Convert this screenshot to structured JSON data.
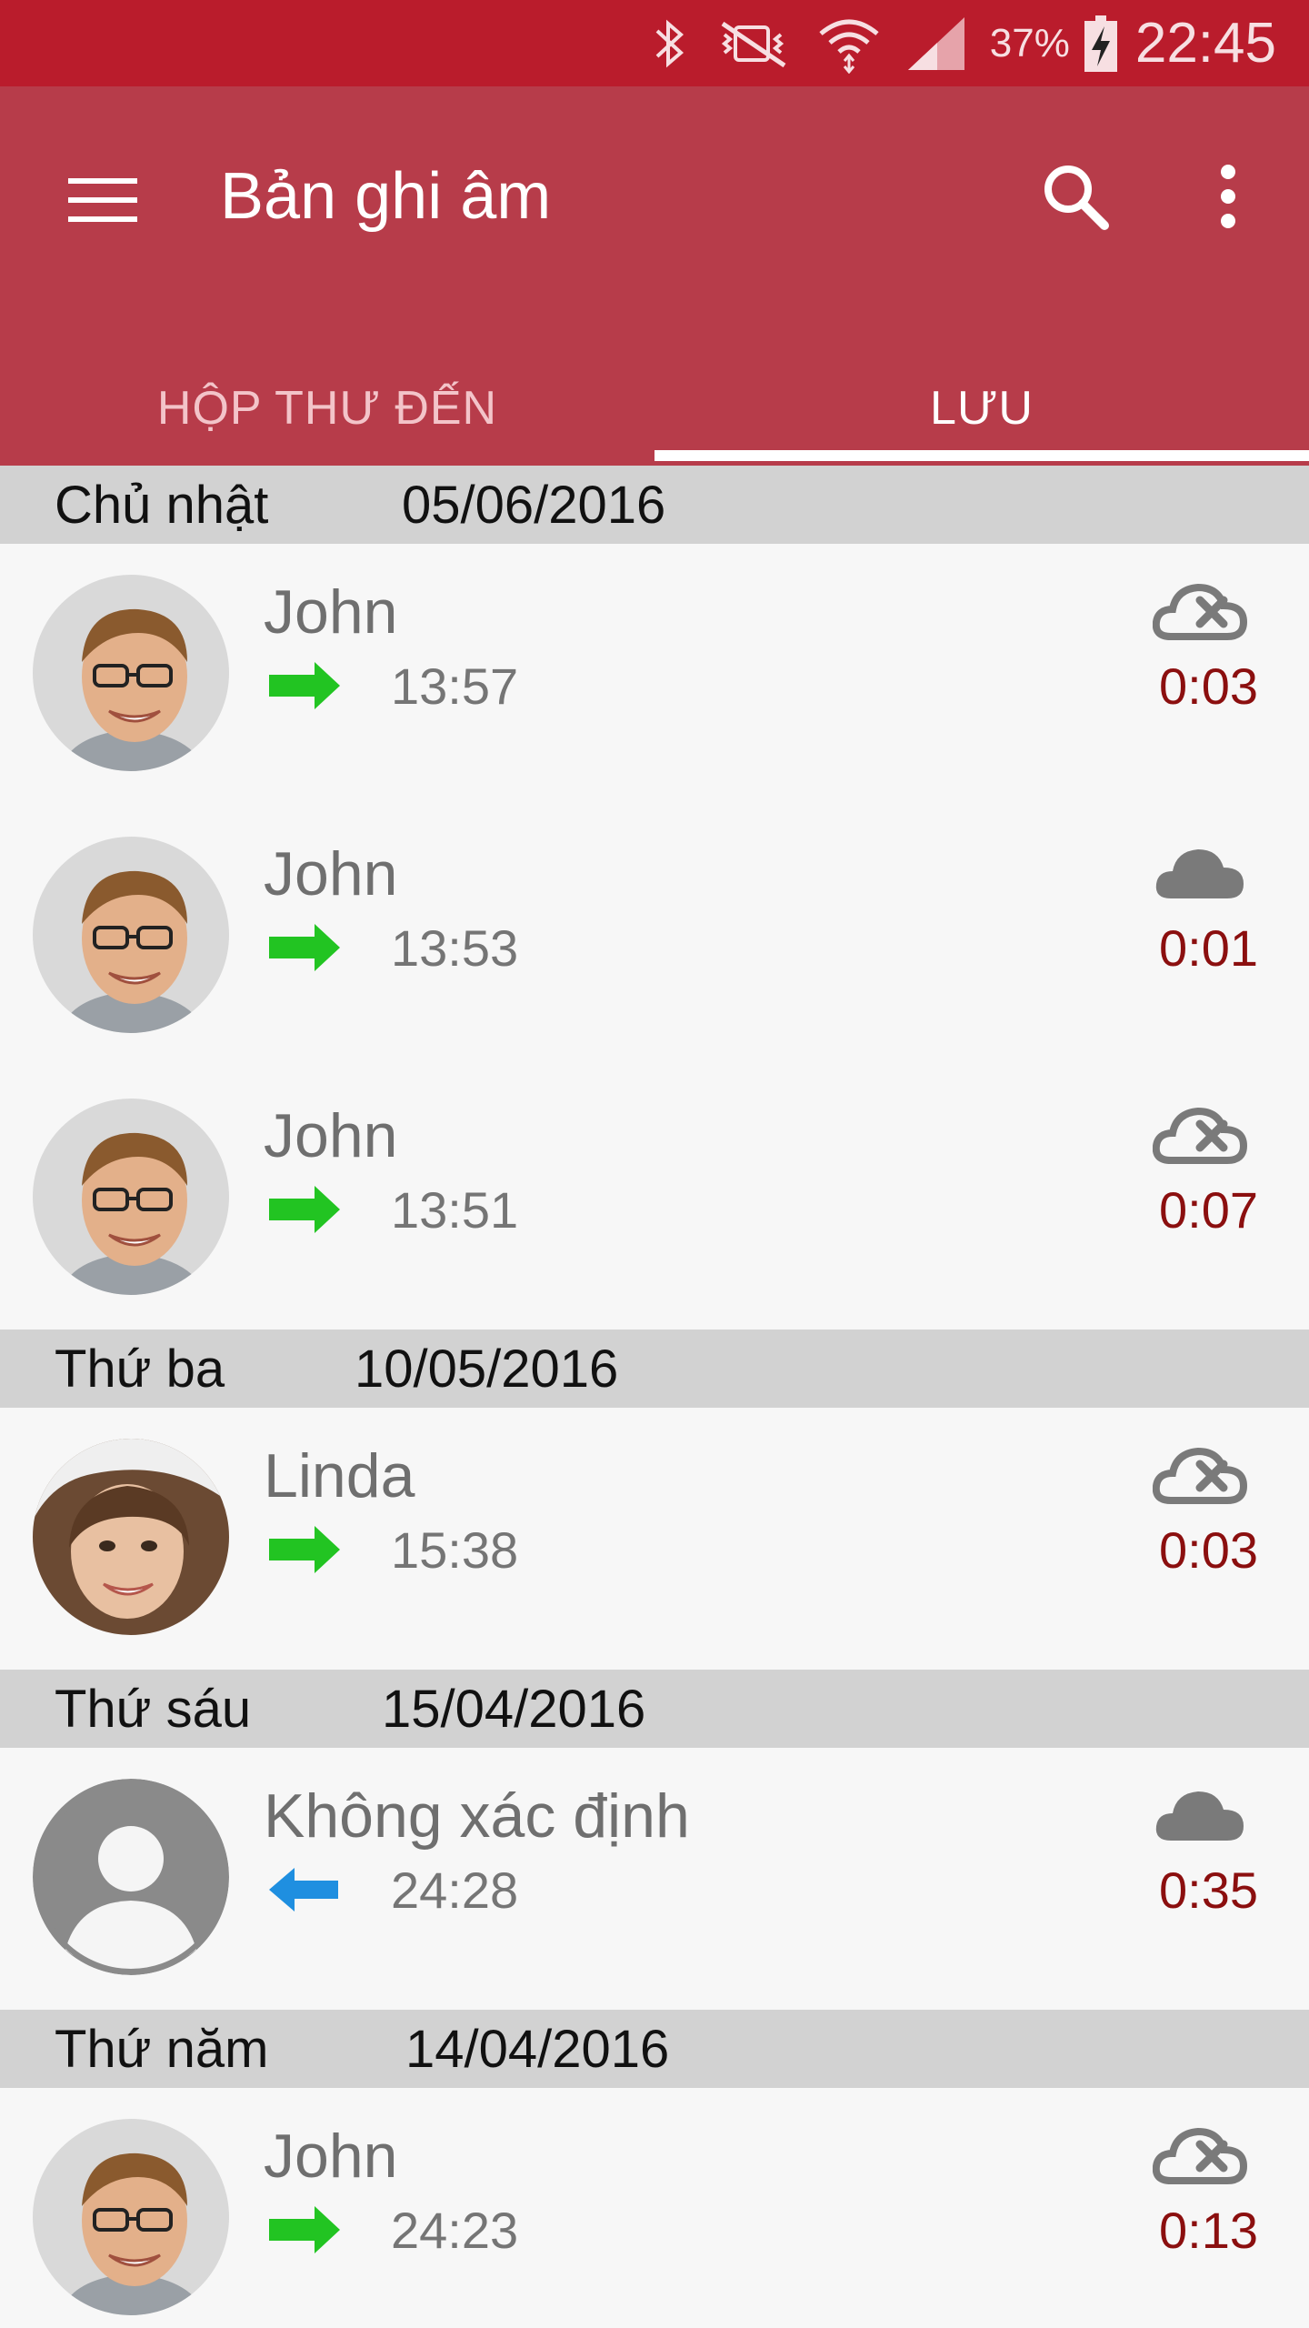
{
  "status_bar": {
    "battery_percent": "37%",
    "time": "22:45",
    "icons": [
      "bluetooth-icon",
      "vibrate-mute-icon",
      "wifi-icon",
      "signal-icon",
      "battery-charging-icon"
    ]
  },
  "app_bar": {
    "title": "Bản ghi âm",
    "icons": [
      "menu-icon",
      "search-icon",
      "more-vert-icon"
    ]
  },
  "tabs": [
    {
      "label": "HỘP THƯ ĐẾN",
      "selected": false
    },
    {
      "label": "LƯU",
      "selected": true
    }
  ],
  "colors": {
    "status_bar": "#ba1c2c",
    "app_bar": "#b73c4a",
    "outgoing_arrow": "#22c422",
    "incoming_arrow": "#1f8fe0",
    "duration": "#8b0f0f"
  },
  "groups": [
    {
      "day": "Chủ nhật",
      "date": "05/06/2016",
      "items": [
        {
          "name": "John",
          "time": "13:57",
          "duration": "0:03",
          "direction": "outgoing",
          "cloud": "cloud-off-icon",
          "avatar": "male-photo"
        },
        {
          "name": "John",
          "time": "13:53",
          "duration": "0:01",
          "direction": "outgoing",
          "cloud": "cloud-icon",
          "avatar": "male-photo"
        },
        {
          "name": "John",
          "time": "13:51",
          "duration": "0:07",
          "direction": "outgoing",
          "cloud": "cloud-off-icon",
          "avatar": "male-photo"
        }
      ]
    },
    {
      "day": "Thứ ba",
      "date": "10/05/2016",
      "items": [
        {
          "name": "Linda",
          "time": "15:38",
          "duration": "0:03",
          "direction": "outgoing",
          "cloud": "cloud-off-icon",
          "avatar": "female-photo"
        }
      ]
    },
    {
      "day": "Thứ sáu",
      "date": "15/04/2016",
      "items": [
        {
          "name": "Không xác định",
          "time": "24:28",
          "duration": "0:35",
          "direction": "incoming",
          "cloud": "cloud-icon",
          "avatar": "default-avatar"
        }
      ]
    },
    {
      "day": "Thứ năm",
      "date": "14/04/2016",
      "items": [
        {
          "name": "John",
          "time": "24:23",
          "duration": "0:13",
          "direction": "outgoing",
          "cloud": "cloud-off-icon",
          "avatar": "male-photo"
        }
      ]
    }
  ]
}
